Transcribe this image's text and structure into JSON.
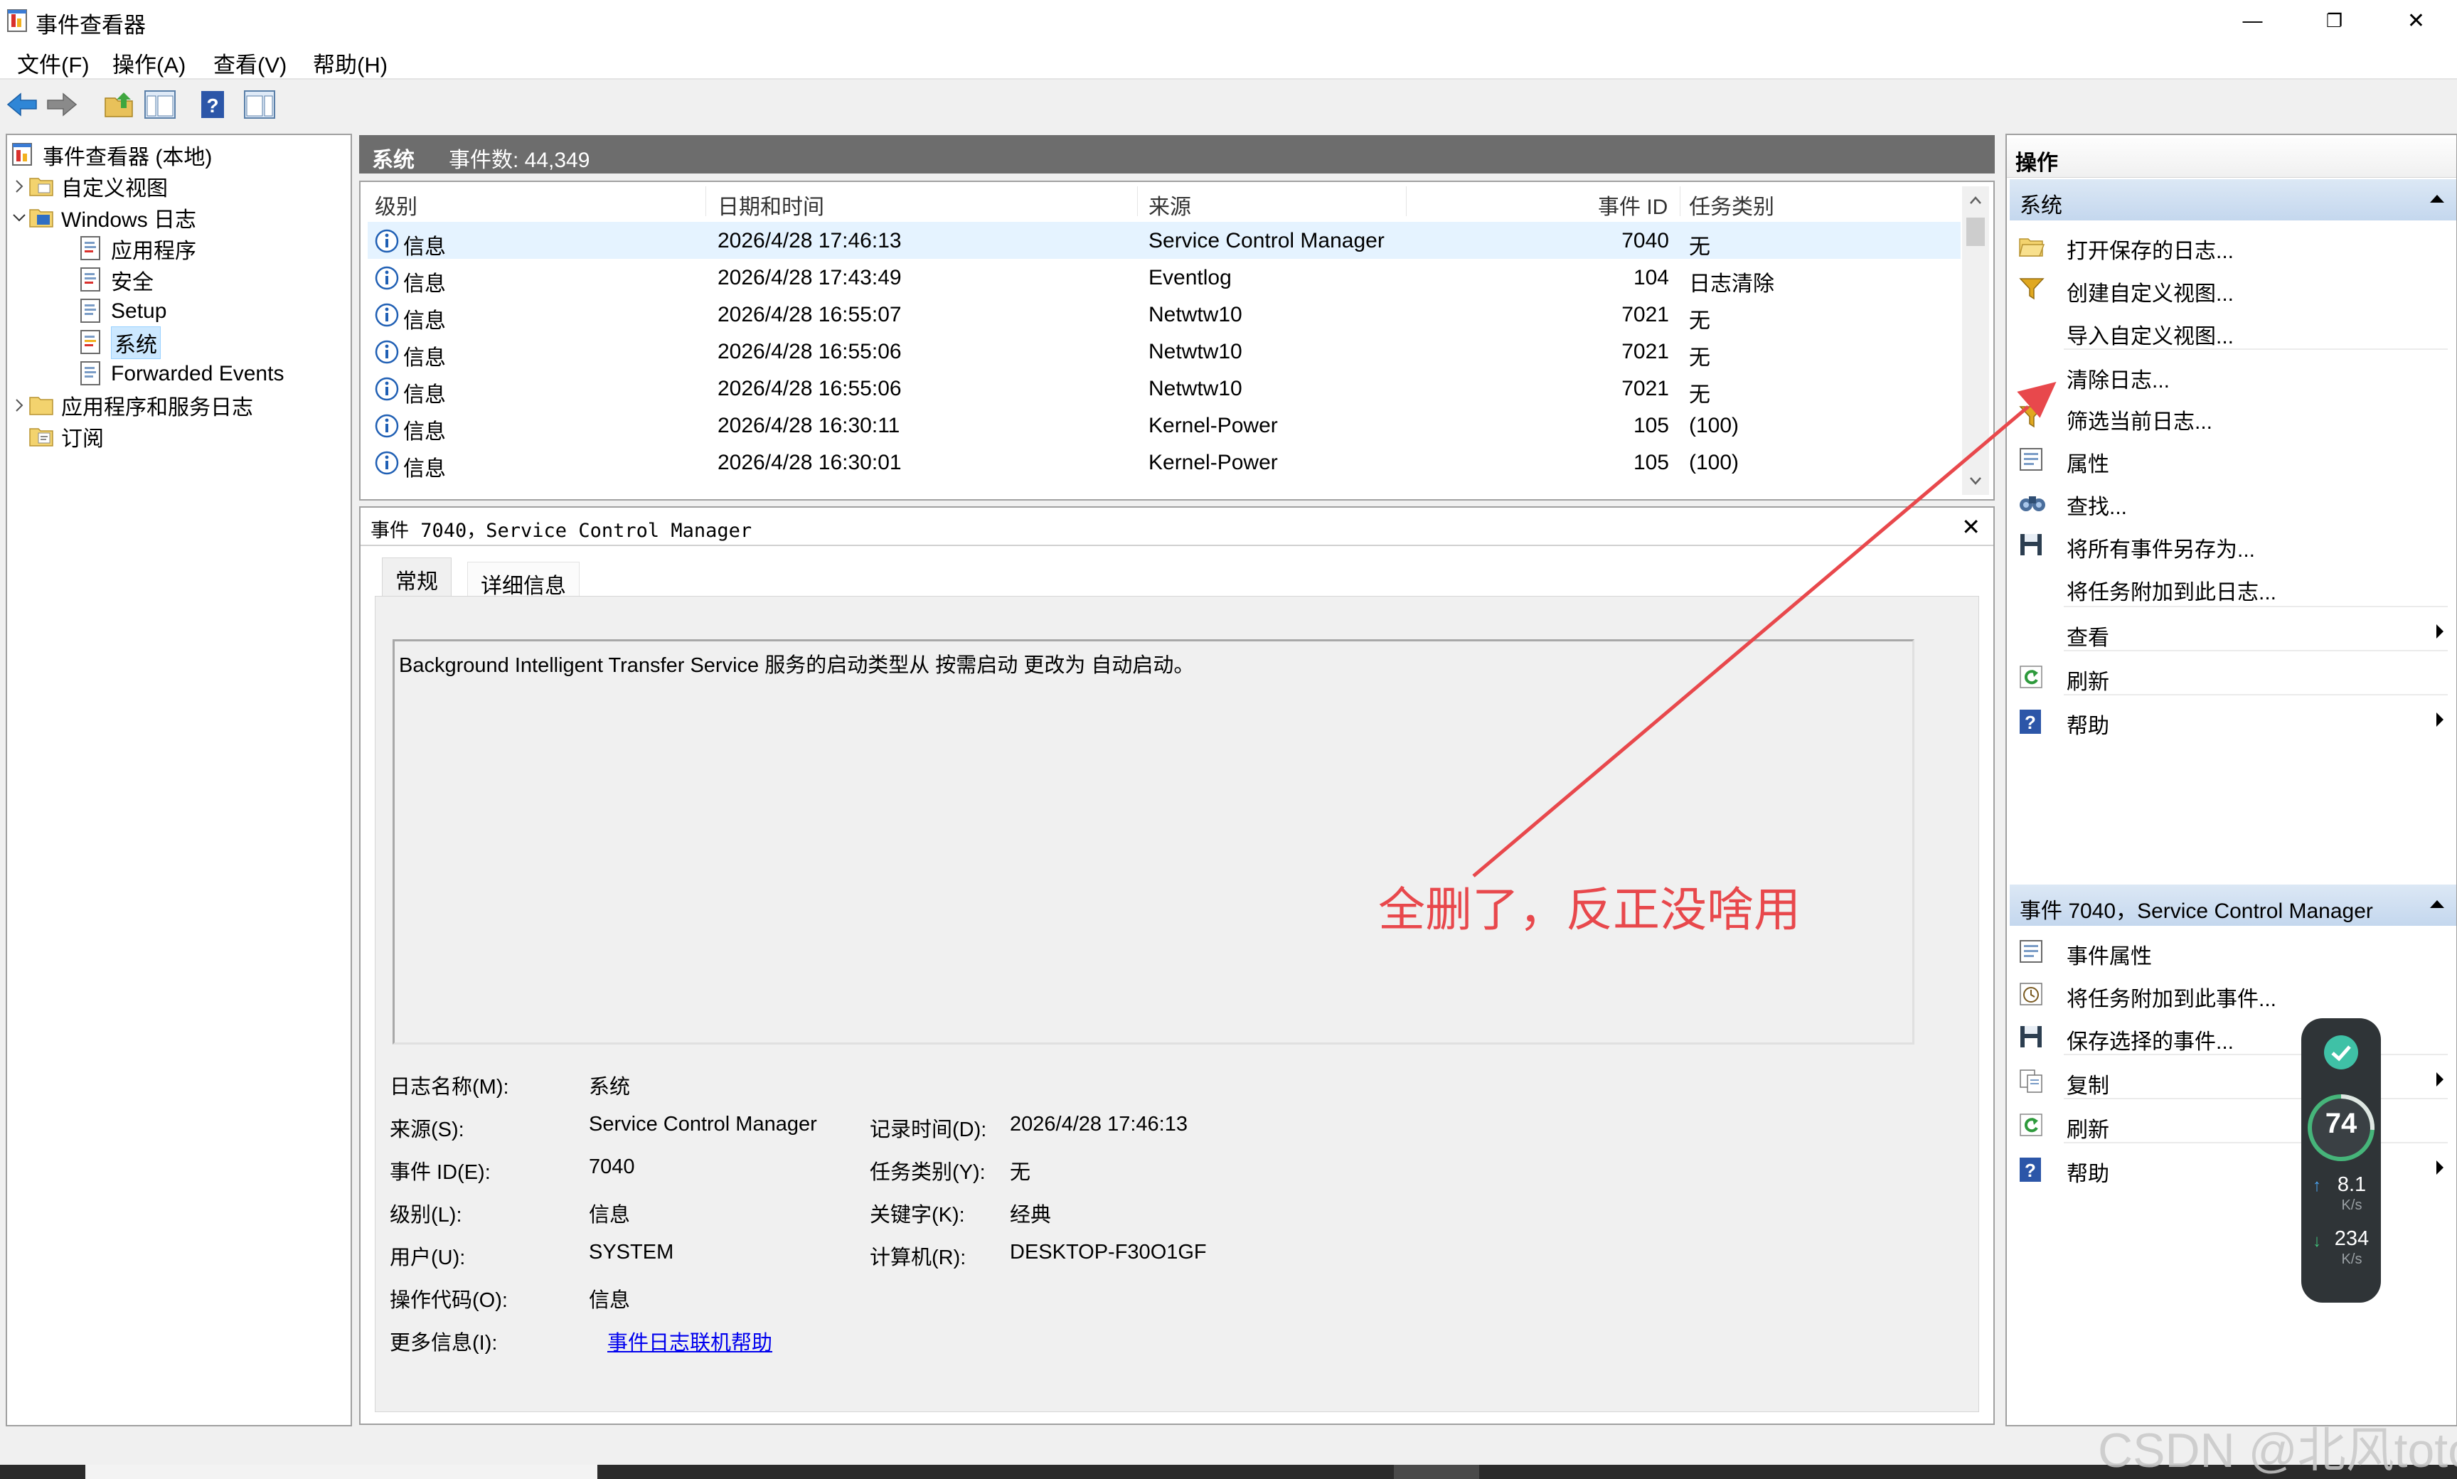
{
  "window": {
    "title": "事件查看器",
    "controls": {
      "minimize": "—",
      "restore": "❐",
      "close": "✕"
    }
  },
  "menu": [
    "文件(F)",
    "操作(A)",
    "查看(V)",
    "帮助(H)"
  ],
  "tree": {
    "root": "事件查看器 (本地)",
    "custom_views": "自定义视图",
    "windows_logs": "Windows 日志",
    "application": "应用程序",
    "security": "安全",
    "setup": "Setup",
    "system": "系统",
    "forwarded": "Forwarded Events",
    "app_services": "应用程序和服务日志",
    "subscriptions": "订阅"
  },
  "center_header": {
    "name": "系统",
    "count": "事件数: 44,349"
  },
  "list": {
    "columns": [
      "级别",
      "日期和时间",
      "来源",
      "事件 ID",
      "任务类别"
    ],
    "rows": [
      {
        "level": "信息",
        "datetime": "2026/4/28 17:46:13",
        "source": "Service Control Manager",
        "id": "7040",
        "category": "无"
      },
      {
        "level": "信息",
        "datetime": "2026/4/28 17:43:49",
        "source": "Eventlog",
        "id": "104",
        "category": "日志清除"
      },
      {
        "level": "信息",
        "datetime": "2026/4/28 16:55:07",
        "source": "Netwtw10",
        "id": "7021",
        "category": "无"
      },
      {
        "level": "信息",
        "datetime": "2026/4/28 16:55:06",
        "source": "Netwtw10",
        "id": "7021",
        "category": "无"
      },
      {
        "level": "信息",
        "datetime": "2026/4/28 16:55:06",
        "source": "Netwtw10",
        "id": "7021",
        "category": "无"
      },
      {
        "level": "信息",
        "datetime": "2026/4/28 16:30:11",
        "source": "Kernel-Power",
        "id": "105",
        "category": "(100)"
      },
      {
        "level": "信息",
        "datetime": "2026/4/28 16:30:01",
        "source": "Kernel-Power",
        "id": "105",
        "category": "(100)"
      }
    ]
  },
  "detail": {
    "title": "事件 7040，Service Control Manager",
    "close": "✕",
    "tabs": [
      "常规",
      "详细信息"
    ],
    "description": "Background Intelligent Transfer Service 服务的启动类型从 按需启动 更改为 自动启动。",
    "props": {
      "log_name_label": "日志名称(M):",
      "log_name": "系统",
      "source_label": "来源(S):",
      "source": "Service Control Manager",
      "logged_label": "记录时间(D):",
      "logged": "2026/4/28 17:46:13",
      "event_id_label": "事件 ID(E):",
      "event_id": "7040",
      "task_label": "任务类别(Y):",
      "task": "无",
      "level_label": "级别(L):",
      "level": "信息",
      "keywords_label": "关键字(K):",
      "keywords": "经典",
      "user_label": "用户(U):",
      "user": "SYSTEM",
      "computer_label": "计算机(R):",
      "computer": "DESKTOP-F30O1GF",
      "opcode_label": "操作代码(O):",
      "opcode": "信息",
      "more_label": "更多信息(I):",
      "more_link": "事件日志联机帮助"
    }
  },
  "actions": {
    "header": "操作",
    "section1": "系统",
    "items1": [
      "打开保存的日志...",
      "创建自定义视图...",
      "导入自定义视图...",
      "清除日志...",
      "筛选当前日志...",
      "属性",
      "查找...",
      "将所有事件另存为...",
      "将任务附加到此日志...",
      "查看",
      "刷新",
      "帮助"
    ],
    "section2": "事件 7040，Service Control Manager",
    "items2": [
      "事件属性",
      "将任务附加到此事件...",
      "保存选择的事件...",
      "复制",
      "刷新",
      "帮助"
    ]
  },
  "annotation": "全删了，反正没啥用",
  "widget": {
    "score": "74",
    "up": "8.1",
    "up_unit": "K/s",
    "down": "234",
    "down_unit": "K/s"
  },
  "watermark": "CSDN @北风toto",
  "colors": {
    "accent_red": "#e8484c",
    "selection": "#cce8ff",
    "section_blue": "#c4d7ee"
  }
}
